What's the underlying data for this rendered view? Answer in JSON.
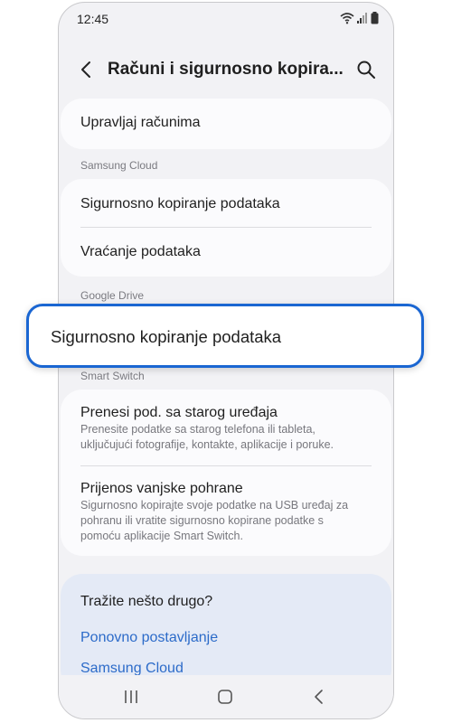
{
  "status_bar": {
    "time": "12:45"
  },
  "header": {
    "title": "Računi i sigurnosno kopira..."
  },
  "manage_card": {
    "label": "Upravljaj računima"
  },
  "samsung_cloud": {
    "section_label": "Samsung Cloud",
    "items": [
      {
        "label": "Sigurnosno kopiranje podataka"
      },
      {
        "label": "Vraćanje podataka"
      }
    ]
  },
  "google_drive": {
    "section_label": "Google Drive",
    "highlighted_item": "Sigurnosno kopiranje podataka"
  },
  "smart_switch": {
    "section_label": "Smart Switch",
    "items": [
      {
        "title": "Prenesi pod. sa starog uređaja",
        "description": "Prenesite podatke sa starog telefona ili tableta, uključujući fotografije, kontakte, aplikacije i poruke."
      },
      {
        "title": "Prijenos vanjske pohrane",
        "description": "Sigurnosno kopirajte svoje podatke na USB uređaj za pohranu ili vratite sigurnosno kopirane podatke s pomoću aplikacije Smart Switch."
      }
    ]
  },
  "help_card": {
    "title": "Tražite nešto drugo?",
    "links": [
      "Ponovno postavljanje",
      "Samsung Cloud"
    ]
  },
  "colors": {
    "highlight_border": "#1a66d2",
    "link": "#2c6bc9",
    "background": "#f2f2f5"
  },
  "icons": {
    "back": "chevron-left-icon",
    "search": "search-icon",
    "wifi": "wifi-icon",
    "signal": "signal-icon",
    "battery": "battery-icon",
    "recents": "recents-icon",
    "home": "home-icon",
    "nav_back": "nav-back-icon"
  }
}
